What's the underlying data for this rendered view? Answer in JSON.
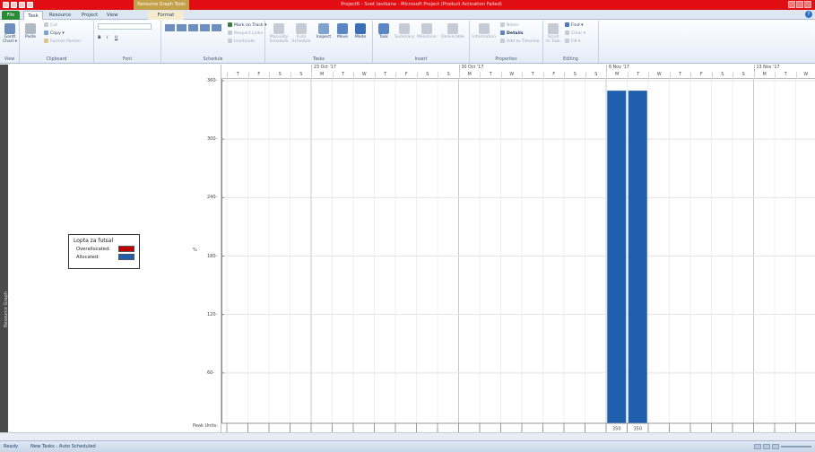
{
  "window": {
    "title": "Project6 - Svet tavikana  -  Microsoft Project (Product Activation Failed)",
    "context_tab": "Resource Graph Tools"
  },
  "tabs": {
    "file": "File",
    "task": "Task",
    "resource": "Resource",
    "project": "Project",
    "view": "View",
    "format": "Format"
  },
  "ribbon": {
    "view": {
      "gantt_chart": "Gantt Chart ▾",
      "group": "View"
    },
    "clipboard": {
      "paste": "Paste",
      "cut": "Cut",
      "copy": "Copy ▾",
      "format_painter": "Format Painter",
      "group": "Clipboard"
    },
    "font": {
      "bold": "B",
      "italic": "I",
      "underline": "U",
      "group": "Font"
    },
    "schedule": {
      "mark_on_track": "Mark on Track ▾",
      "respect_links": "Respect Links",
      "inactivate": "Inactivate",
      "group": "Schedule"
    },
    "tasks": {
      "manually_schedule": "Manually Schedule",
      "auto_schedule": "Auto Schedule",
      "inspect": "Inspect",
      "move": "Move",
      "mode": "Mode",
      "group": "Tasks"
    },
    "insert": {
      "task": "Task",
      "summary": "Summary",
      "milestone": "Milestone",
      "deliverable": "Deliverable",
      "group": "Insert"
    },
    "properties": {
      "information": "Information",
      "notes": "Notes",
      "details": "Details",
      "add_to_timeline": "Add to Timeline",
      "group": "Properties"
    },
    "editing": {
      "scroll_to_task": "Scroll to Task",
      "find": "Find ▾",
      "clear": "Clear ▾",
      "fill": "Fill ▾",
      "group": "Editing"
    }
  },
  "sidebar": {
    "label": "Resource Graph"
  },
  "legend": {
    "title": "Lopta za futsal",
    "overallocated_label": "Overallocated:",
    "allocated_label": "Allocated:",
    "overallocated_color": "#c00000",
    "allocated_color": "#1f5fad"
  },
  "timescale": {
    "weeks": [
      "23 Oct '17",
      "30 Oct '17",
      "6 Nov '17",
      "13 Nov '17"
    ],
    "days": [
      "T",
      "F",
      "S",
      "S",
      "M",
      "T",
      "W",
      "T",
      "F",
      "S",
      "S",
      "M",
      "T",
      "W",
      "T",
      "F",
      "S",
      "S",
      "M",
      "T",
      "W",
      "T",
      "F",
      "S",
      "S",
      "M",
      "T",
      "W"
    ]
  },
  "chart_data": {
    "type": "bar",
    "ylabel": "%",
    "ylim": [
      0,
      360
    ],
    "yticks": [
      60,
      120,
      180,
      240,
      300,
      360
    ],
    "peak_units_label": "Peak Units:",
    "categories": [
      "T",
      "F",
      "S",
      "S",
      "M",
      "T",
      "W",
      "T",
      "F",
      "S",
      "S",
      "M",
      "T",
      "W",
      "T",
      "F",
      "S",
      "S",
      "M",
      "T",
      "W",
      "T",
      "F",
      "S",
      "S",
      "M",
      "T",
      "W"
    ],
    "series": [
      {
        "values": [
          0,
          0,
          0,
          0,
          0,
          0,
          0,
          0,
          0,
          0,
          0,
          0,
          0,
          0,
          0,
          0,
          0,
          0,
          350,
          350,
          0,
          0,
          0,
          0,
          0,
          0,
          0,
          0
        ],
        "color": "#1f5fad"
      }
    ],
    "peak_units": [
      "",
      "",
      "",
      "",
      "",
      "",
      "",
      "",
      "",
      "",
      "",
      "",
      "",
      "",
      "",
      "",
      "",
      "",
      "350",
      "350",
      "",
      "",
      "",
      "",
      "",
      "",
      "",
      ""
    ]
  },
  "statusbar": {
    "ready": "Ready",
    "new_tasks": "New Tasks : Auto Scheduled"
  }
}
